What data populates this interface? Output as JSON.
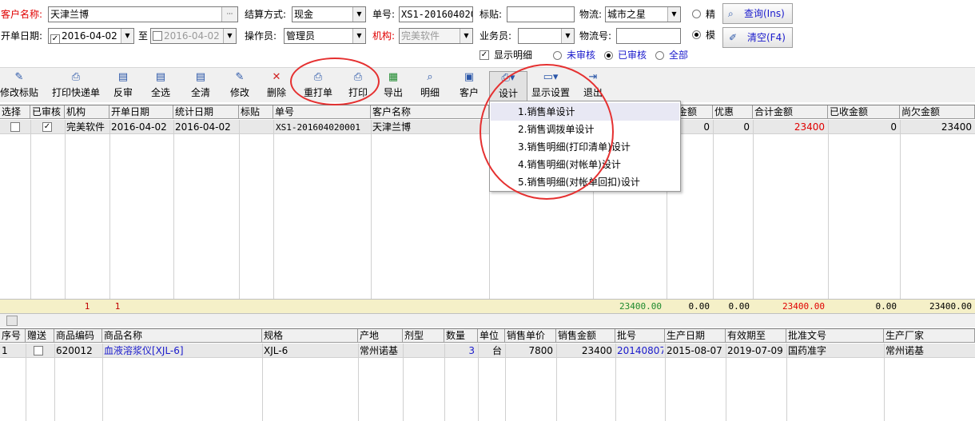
{
  "filters": {
    "customer_label": "客户名称:",
    "customer_value": "天津兰博",
    "customer_btn": "···",
    "settle_label": "结算方式:",
    "settle_value": "现金",
    "order_label": "单号:",
    "order_value": "XS1-201604020",
    "sticker_label": "标贴:",
    "sticker_value": "",
    "logistics_label": "物流:",
    "logistics_value": "城市之星",
    "date_label": "开单日期:",
    "date_from": "2016-04-02",
    "to_label": "至",
    "date_to": "2016-04-02",
    "operator_label": "操作员:",
    "operator_value": "管理员",
    "org_label": "机构:",
    "org_value": "完美软件",
    "sales_label": "业务员:",
    "sales_value": "",
    "logistics_no_label": "物流号:",
    "logistics_no_value": "",
    "exact_label": "精",
    "fuzzy_label": "模",
    "show_detail_label": "显示明细",
    "unaudited_label": "未审核",
    "audited_label": "已审核",
    "all_label": "全部",
    "query_btn": "查询(Ins)",
    "clear_btn": "清空(F4)"
  },
  "toolbar": [
    {
      "label": "修改标贴",
      "icon": "edit-icon",
      "glyph": "✎"
    },
    {
      "label": "打印快递单",
      "icon": "printer-icon",
      "glyph": "⎙"
    },
    {
      "label": "反审",
      "icon": "doc-icon",
      "glyph": "▤"
    },
    {
      "label": "全选",
      "icon": "doc-check-icon",
      "glyph": "▤"
    },
    {
      "label": "全清",
      "icon": "doc-clear-icon",
      "glyph": "▤"
    },
    {
      "label": "修改",
      "icon": "edit-doc-icon",
      "glyph": "✎"
    },
    {
      "label": "删除",
      "icon": "delete-icon",
      "glyph": "✕"
    },
    {
      "label": "重打单",
      "icon": "printer-icon",
      "glyph": "⎙"
    },
    {
      "label": "打印",
      "icon": "printer-icon",
      "glyph": "⎙"
    },
    {
      "label": "导出",
      "icon": "excel-icon",
      "glyph": "▦"
    },
    {
      "label": "明细",
      "icon": "magnifier-icon",
      "glyph": "⌕"
    },
    {
      "label": "客户",
      "icon": "customer-icon",
      "glyph": "▣"
    },
    {
      "label": "设计",
      "icon": "design-icon",
      "glyph": "⎙▾"
    },
    {
      "label": "显示设置",
      "icon": "display-settings-icon",
      "glyph": "▭▾"
    },
    {
      "label": "退出",
      "icon": "exit-icon",
      "glyph": "⇥"
    }
  ],
  "design_menu": [
    "1.销售单设计",
    "2.销售调拨单设计",
    "3.销售明细(打印清单)设计",
    "4.销售明细(对帐单)设计",
    "5.销售明细(对帐单回扣)设计"
  ],
  "orders": {
    "headers": [
      "选择",
      "已审核",
      "机构",
      "开单日期",
      "统计日期",
      "标贴",
      "单号",
      "客户名称",
      "费金额",
      "优惠",
      "合计金额",
      "已收金额",
      "尚欠金额"
    ],
    "row": {
      "org": "完美软件",
      "open_date": "2016-04-02",
      "stat_date": "2016-04-02",
      "order_no": "XS1-201604020001",
      "customer": "天津兰博",
      "fee": "0",
      "discount": "0",
      "total": "23400",
      "received": "0",
      "owed": "23400"
    },
    "footer": {
      "count_org": "1",
      "count_date": "1",
      "sum_a": "23400.00",
      "fee": "0.00",
      "discount": "0.00",
      "total": "23400.00",
      "received": "0.00",
      "owed": "23400.00"
    }
  },
  "items": {
    "headers": [
      "序号",
      "赠送",
      "商品编码",
      "商品名称",
      "规格",
      "产地",
      "剂型",
      "数量",
      "单位",
      "销售单价",
      "销售金额",
      "批号",
      "生产日期",
      "有效期至",
      "批准文号",
      "生产厂家"
    ],
    "row": {
      "seq": "1",
      "code": "620012",
      "name": "血液溶浆仪[XJL-6]",
      "spec": "XJL-6",
      "origin": "常州诺基",
      "form": "",
      "qty": "3",
      "unit": "台",
      "price": "7800",
      "amount": "23400",
      "batch": "20140807",
      "mfg_date": "2015-08-07",
      "expiry": "2019-07-09",
      "approval": "国药准字",
      "maker": "常州诺基"
    }
  },
  "colors": {
    "highlight_red": "#e53030",
    "footer_bg": "#f5f0c8",
    "link_blue": "#1a1acc"
  }
}
